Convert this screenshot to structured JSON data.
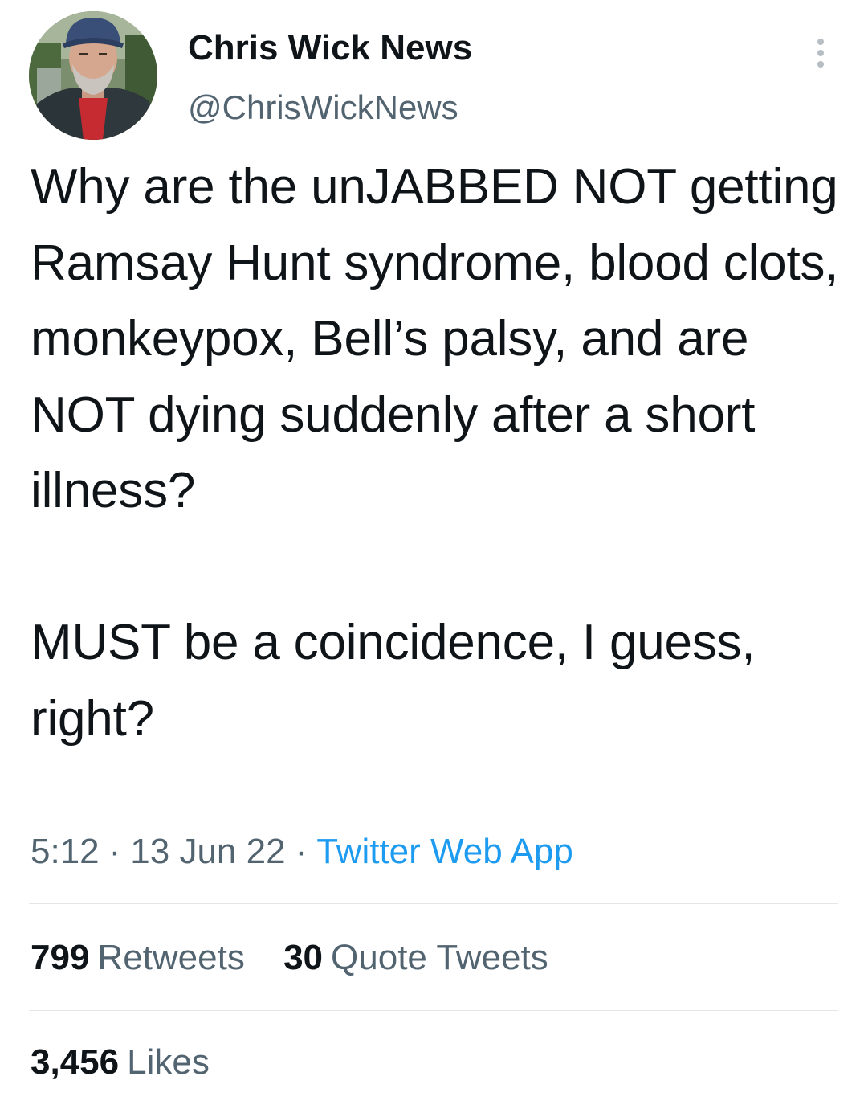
{
  "author": {
    "display_name": "Chris Wick News",
    "handle": "@ChrisWickNews"
  },
  "tweet": {
    "paragraphs": [
      "Why are the unJABBED NOT getting Ramsay Hunt syndrome, blood clots, monkeypox, Bell’s palsy, and are NOT dying suddenly after a short illness?",
      "MUST be a coincidence, I guess, right?"
    ]
  },
  "meta": {
    "time": "5:12",
    "separator": "·",
    "date": "13 Jun 22",
    "source": "Twitter Web App"
  },
  "stats": {
    "retweets_count": "799",
    "retweets_label": "Retweets",
    "quote_count": "30",
    "quote_label": "Quote Tweets",
    "likes_count": "3,456",
    "likes_label": "Likes"
  },
  "icons": {
    "more": "more-vertical-icon"
  },
  "colors": {
    "text_primary": "#0f1419",
    "text_secondary": "#536471",
    "link": "#1d9bf0",
    "divider": "#e3e7ea"
  }
}
